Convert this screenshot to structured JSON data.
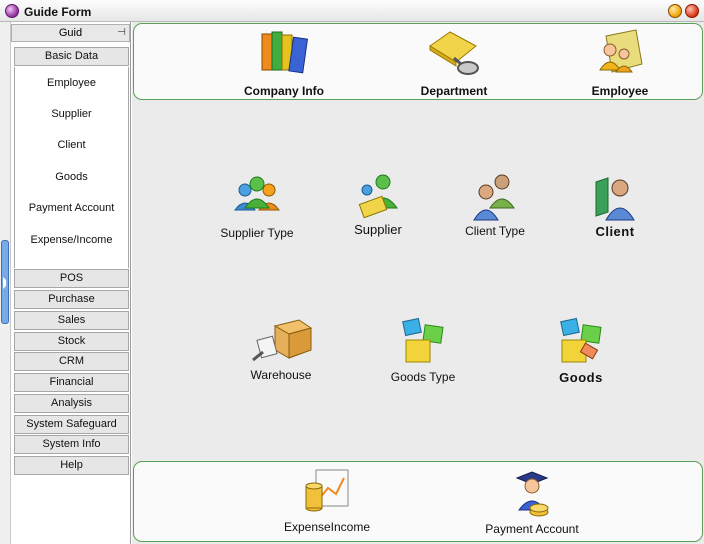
{
  "window": {
    "title": "Guide Form"
  },
  "sidebar": {
    "header": "Guid",
    "active_group": "Basic Data",
    "basic_items": [
      "Employee",
      "Supplier",
      "Client",
      "Goods",
      "Payment Account",
      "Expense/Income"
    ],
    "groups": [
      "POS",
      "Purchase",
      "Sales",
      "Stock",
      "CRM",
      "Financial",
      "Analysis",
      "System Safeguard",
      "System Info",
      "Help"
    ]
  },
  "main": {
    "top_row": [
      {
        "label": "Company Info",
        "icon": "books-icon"
      },
      {
        "label": "Department",
        "icon": "folder-search-icon"
      },
      {
        "label": "Employee",
        "icon": "employee-folder-icon"
      }
    ],
    "middle_row_1": [
      {
        "label": "Supplier Type",
        "icon": "users-group-icon"
      },
      {
        "label": "Supplier",
        "icon": "supplier-icon"
      },
      {
        "label": "Client Type",
        "icon": "client-type-icon"
      },
      {
        "label": "Client",
        "icon": "client-icon"
      }
    ],
    "middle_row_2": [
      {
        "label": "Warehouse",
        "icon": "warehouse-box-icon"
      },
      {
        "label": "Goods Type",
        "icon": "goods-type-cubes-icon"
      },
      {
        "label": "Goods",
        "icon": "goods-cubes-icon"
      }
    ],
    "bottom_row": [
      {
        "label": "ExpenseIncome",
        "icon": "expense-chart-icon"
      },
      {
        "label": "Payment Account",
        "icon": "graduate-coins-icon"
      }
    ]
  }
}
